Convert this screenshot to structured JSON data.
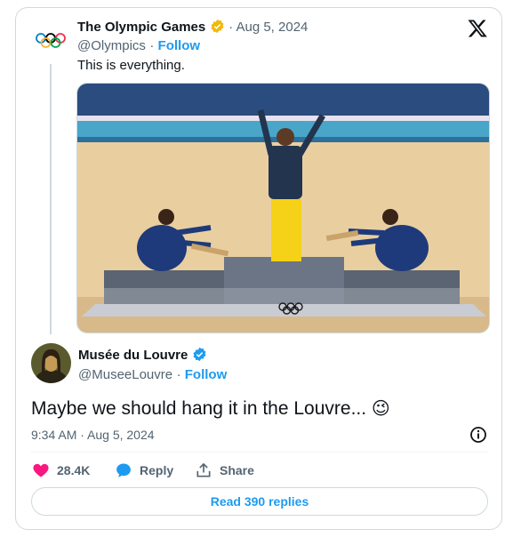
{
  "quoted": {
    "author": "The Olympic Games",
    "date": "Aug 5, 2024",
    "handle": "@Olympics",
    "follow": "Follow",
    "text": "This is everything."
  },
  "tweet": {
    "author": "Musée du Louvre",
    "handle": "@MuseeLouvre",
    "follow": "Follow",
    "text": "Maybe we should hang it in the Louvre...",
    "emoji": "😉",
    "timestamp": "9:34 AM · Aug 5, 2024"
  },
  "actions": {
    "likes": "28.4K",
    "reply": "Reply",
    "share": "Share"
  },
  "read_replies": "Read 390 replies",
  "colors": {
    "accent": "#1d9bf0",
    "like": "#f91880",
    "verified": "#f0b90b"
  },
  "icons": [
    "olympic-rings-icon",
    "x-logo-icon",
    "verified-badge-icon",
    "info-icon",
    "heart-icon",
    "reply-icon",
    "share-icon"
  ]
}
